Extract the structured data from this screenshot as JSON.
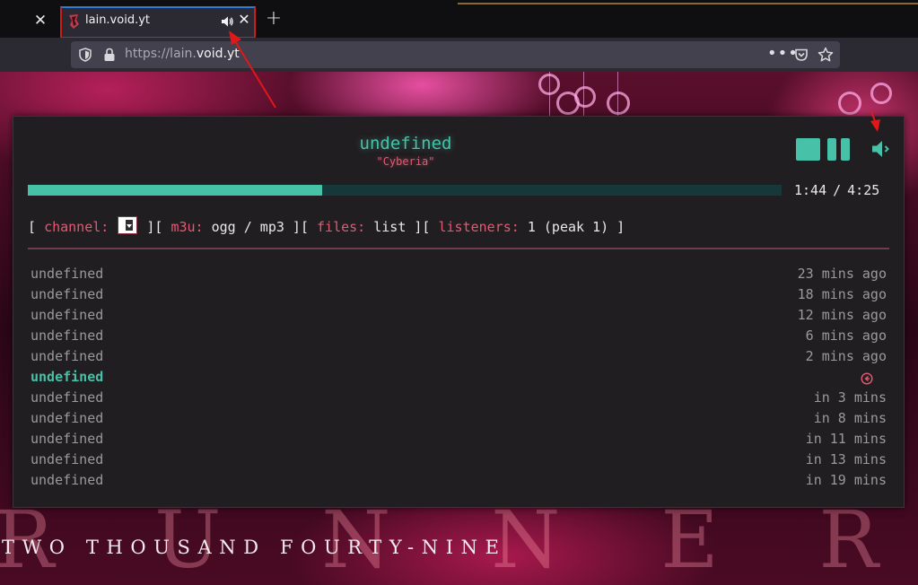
{
  "browser": {
    "tab": {
      "title": "lain.void.yt",
      "favicon": "lain-favicon",
      "audio_icon": "speaker-icon"
    },
    "url": {
      "prefix": "https://lain.",
      "host": "void.yt"
    }
  },
  "background": {
    "subtitle": "TWO THOUSAND FOURTY-NINE",
    "title_letters": "R U N N E R"
  },
  "player": {
    "now_playing": "undefined",
    "station": "\"Cyberia\"",
    "progress_fraction": 0.39,
    "elapsed": "1:44",
    "separator": "/",
    "duration": "4:25",
    "info": {
      "open": "[",
      "channel_key": "channel:",
      "after_channel": " ][",
      "m3u_key": "m3u:",
      "m3u_val": " ogg / mp3 ][",
      "files_key": "files:",
      "files_val": " list ][",
      "listeners_key": "listeners:",
      "listeners_val": " 1 (peak 1) ]"
    },
    "colors": {
      "accent": "#47c1a8",
      "key": "#e45a73",
      "panel": "#211e21"
    },
    "history": [
      {
        "title": "undefined",
        "when": "23 mins ago"
      },
      {
        "title": "undefined",
        "when": "18 mins ago"
      },
      {
        "title": "undefined",
        "when": "12 mins ago"
      },
      {
        "title": "undefined",
        "when": " 6 mins ago"
      },
      {
        "title": "undefined",
        "when": " 2 mins ago"
      }
    ],
    "current": {
      "title": "undefined",
      "icon": "arrow-left-circle-icon"
    },
    "queue": [
      {
        "title": "undefined",
        "when": "in 3 mins"
      },
      {
        "title": "undefined",
        "when": "in 8 mins"
      },
      {
        "title": "undefined",
        "when": "in 11 mins"
      },
      {
        "title": "undefined",
        "when": "in 13 mins"
      },
      {
        "title": "undefined",
        "when": "in 19 mins"
      }
    ]
  }
}
